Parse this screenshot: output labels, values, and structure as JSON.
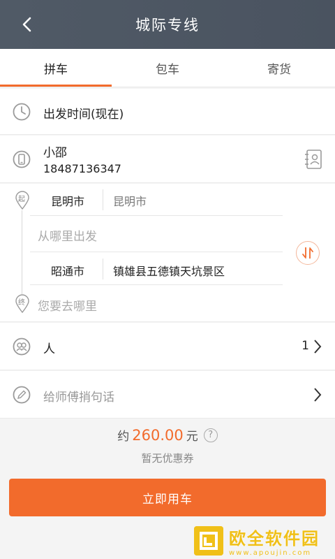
{
  "header": {
    "title": "城际专线"
  },
  "tabs": [
    {
      "label": "拼车",
      "active": true
    },
    {
      "label": "包车",
      "active": false
    },
    {
      "label": "寄货",
      "active": false
    }
  ],
  "departure": {
    "label": "出发时间(现在)"
  },
  "contact": {
    "name": "小邵",
    "phone": "18487136347"
  },
  "route": {
    "start_marker": "起",
    "end_marker": "终",
    "from_city": "昆明市",
    "from_city_value": "昆明市",
    "from_placeholder": "从哪里出发",
    "to_city": "昭通市",
    "to_address": "镇雄县五德镇天坑景区",
    "to_placeholder": "您要去哪里"
  },
  "passengers": {
    "label": "人",
    "count": "1"
  },
  "message": {
    "placeholder": "给师傅捎句话"
  },
  "price": {
    "prefix": "约",
    "amount": "260.00",
    "unit": "元",
    "help": "?",
    "coupon": "暂无优惠券"
  },
  "submit": {
    "label": "立即用车"
  },
  "watermark": {
    "title": "欧全软件园",
    "url": "www.apoujin.com"
  },
  "colors": {
    "accent": "#f26b2c",
    "header": "#505a66"
  }
}
